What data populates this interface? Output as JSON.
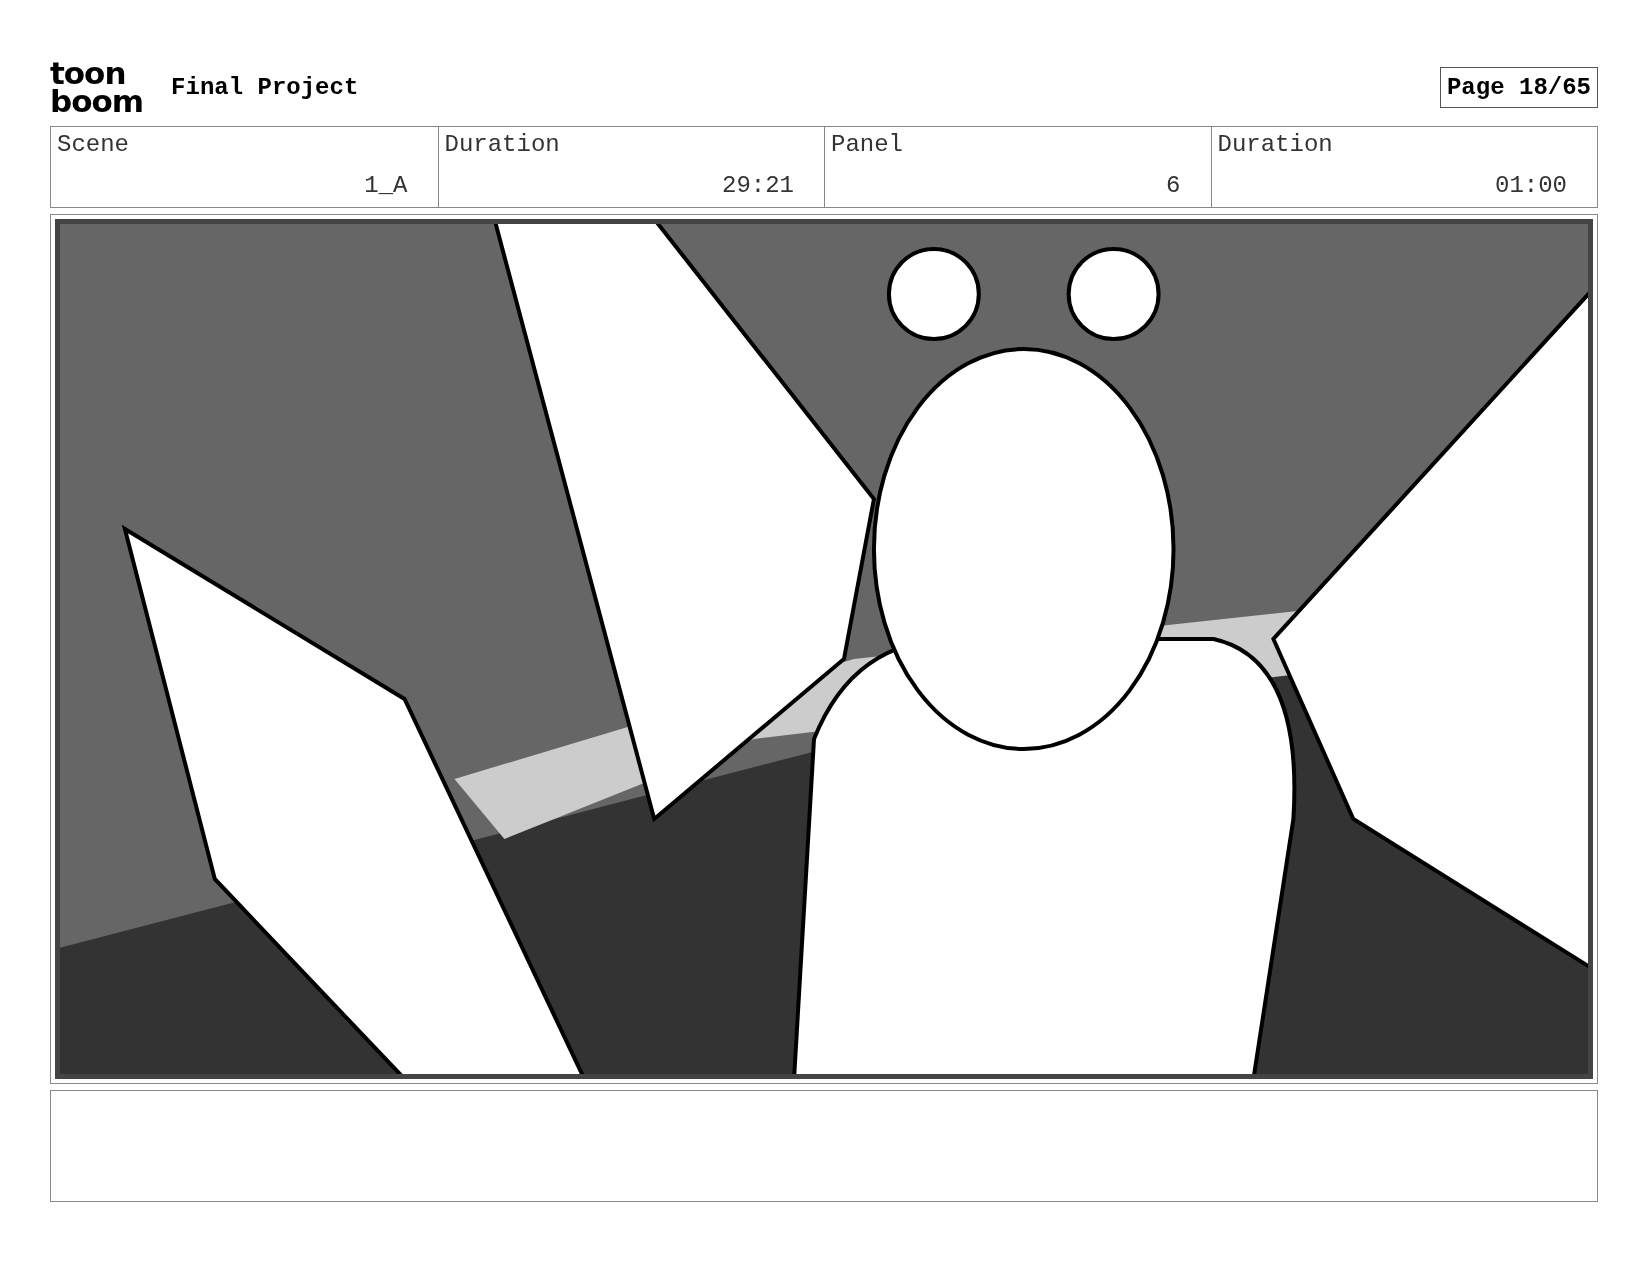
{
  "logo": [
    "toon",
    "boom"
  ],
  "title": "Final Project",
  "page": "Page 18/65",
  "fields": [
    {
      "label": "Scene",
      "value": "1_A"
    },
    {
      "label": "Duration",
      "value": "29:21"
    },
    {
      "label": "Panel",
      "value": "6"
    },
    {
      "label": "Duration",
      "value": "01:00"
    }
  ]
}
